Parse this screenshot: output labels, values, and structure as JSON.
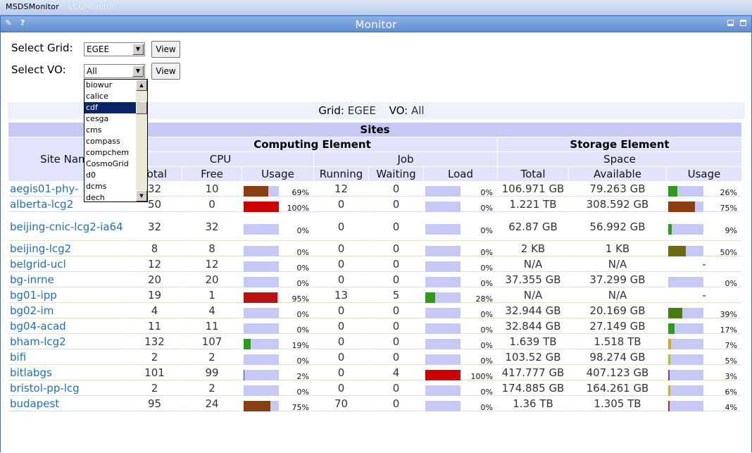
{
  "tabs": [
    {
      "label": "MSDSMonitor",
      "active": true
    },
    {
      "label": "LCGMonitor",
      "active": false
    }
  ],
  "portlet": {
    "title": "Monitor"
  },
  "controls": {
    "grid_label": "Select Grid:",
    "grid_value": "EGEE",
    "vo_label": "Select VO:",
    "vo_value": "All",
    "view_label": "View"
  },
  "vo_dropdown": {
    "options": [
      "biowur",
      "calice",
      "cdf",
      "cesga",
      "cms",
      "compass",
      "compchem",
      "CosmoGrid",
      "d0",
      "dcms",
      "dech"
    ],
    "selected": "cdf"
  },
  "info": {
    "grid_key": "Grid:",
    "grid_value": "EGEE",
    "vo_key": "VO:",
    "vo_value": "All"
  },
  "table": {
    "sites_title": "Sites",
    "site_name_header": "Site Name",
    "computing_element": "Computing Element",
    "storage_element": "Storage Element",
    "cpu_header": "CPU",
    "job_header": "Job",
    "space_header": "Space",
    "columns": [
      "Total",
      "Free",
      "Usage",
      "Running",
      "Waiting",
      "Load",
      "Total",
      "Available",
      "Usage"
    ],
    "rows": [
      {
        "name": "aegis01-phy-",
        "total": "32",
        "free": "10",
        "cpu_pct": 69,
        "cpu_color": "#8b3e0f",
        "running": "12",
        "waiting": "0",
        "load_pct": 0,
        "load_color": "#c6c9f5",
        "space_total": "106.971 GB",
        "available": "79.263 GB",
        "se_pct": 26,
        "se_color": "#2e9b1a",
        "se_text": "26%"
      },
      {
        "name": "alberta-lcg2",
        "total": "50",
        "free": "0",
        "cpu_pct": 100,
        "cpu_color": "#cc0000",
        "running": "0",
        "waiting": "0",
        "load_pct": 0,
        "load_color": "#c6c9f5",
        "space_total": "1.221 TB",
        "available": "308.592 GB",
        "se_pct": 75,
        "se_color": "#8b3e0f",
        "se_text": "75%"
      },
      {
        "name": "beijing-cnic-lcg2-ia64",
        "total": "32",
        "free": "32",
        "cpu_pct": 0,
        "cpu_color": "#c6c9f5",
        "running": "0",
        "waiting": "0",
        "load_pct": 0,
        "load_color": "#c6c9f5",
        "space_total": "62.87 GB",
        "available": "56.992 GB",
        "se_pct": 9,
        "se_color": "#2e9b1a",
        "se_text": "9%"
      },
      {
        "name": "beijing-lcg2",
        "total": "8",
        "free": "8",
        "cpu_pct": 0,
        "cpu_color": "#c6c9f5",
        "running": "0",
        "waiting": "0",
        "load_pct": 0,
        "load_color": "#c6c9f5",
        "space_total": "2 KB",
        "available": "1 KB",
        "se_pct": 50,
        "se_color": "#6b6b0f",
        "se_text": "50%"
      },
      {
        "name": "belgrid-ucl",
        "total": "12",
        "free": "12",
        "cpu_pct": 0,
        "cpu_color": "#c6c9f5",
        "running": "0",
        "waiting": "0",
        "load_pct": 0,
        "load_color": "#c6c9f5",
        "space_total": "N/A",
        "available": "N/A",
        "se_pct": null,
        "se_color": "",
        "se_text": "-"
      },
      {
        "name": "bg-inrne",
        "total": "20",
        "free": "20",
        "cpu_pct": 0,
        "cpu_color": "#c6c9f5",
        "running": "0",
        "waiting": "0",
        "load_pct": 0,
        "load_color": "#c6c9f5",
        "space_total": "37.355 GB",
        "available": "37.299 GB",
        "se_pct": 0,
        "se_color": "#c6c9f5",
        "se_text": "0%"
      },
      {
        "name": "bg01-ipp",
        "total": "19",
        "free": "1",
        "cpu_pct": 95,
        "cpu_color": "#bb1111",
        "running": "13",
        "waiting": "5",
        "load_pct": 28,
        "load_color": "#2e9b1a",
        "space_total": "N/A",
        "available": "N/A",
        "se_pct": null,
        "se_color": "",
        "se_text": "-"
      },
      {
        "name": "bg02-im",
        "total": "4",
        "free": "4",
        "cpu_pct": 0,
        "cpu_color": "#c6c9f5",
        "running": "0",
        "waiting": "0",
        "load_pct": 0,
        "load_color": "#c6c9f5",
        "space_total": "32.944 GB",
        "available": "20.169 GB",
        "se_pct": 39,
        "se_color": "#4a7a10",
        "se_text": "39%"
      },
      {
        "name": "bg04-acad",
        "total": "11",
        "free": "11",
        "cpu_pct": 0,
        "cpu_color": "#c6c9f5",
        "running": "0",
        "waiting": "0",
        "load_pct": 0,
        "load_color": "#c6c9f5",
        "space_total": "32.844 GB",
        "available": "27.149 GB",
        "se_pct": 17,
        "se_color": "#2e9b1a",
        "se_text": "17%"
      },
      {
        "name": "bham-lcg2",
        "total": "132",
        "free": "107",
        "cpu_pct": 19,
        "cpu_color": "#2e9b1a",
        "running": "0",
        "waiting": "0",
        "load_pct": 0,
        "load_color": "#c6c9f5",
        "space_total": "1.639 TB",
        "available": "1.518 TB",
        "se_pct": 7,
        "se_color": "#e8a020",
        "se_text": "7%"
      },
      {
        "name": "bifi",
        "total": "2",
        "free": "2",
        "cpu_pct": 0,
        "cpu_color": "#c6c9f5",
        "running": "0",
        "waiting": "0",
        "load_pct": 0,
        "load_color": "#c6c9f5",
        "space_total": "103.52 GB",
        "available": "98.274 GB",
        "se_pct": 5,
        "se_color": "#9ad020",
        "se_text": "5%"
      },
      {
        "name": "bitlabgs",
        "total": "101",
        "free": "99",
        "cpu_pct": 2,
        "cpu_color": "#2e4ea0",
        "running": "0",
        "waiting": "4",
        "load_pct": 100,
        "load_color": "#cc0000",
        "space_total": "417.777 GB",
        "available": "407.123 GB",
        "se_pct": 3,
        "se_color": "#7a3ea0",
        "se_text": "3%"
      },
      {
        "name": "bristol-pp-lcg",
        "total": "2",
        "free": "2",
        "cpu_pct": 0,
        "cpu_color": "#c6c9f5",
        "running": "0",
        "waiting": "0",
        "load_pct": 0,
        "load_color": "#c6c9f5",
        "space_total": "174.885 GB",
        "available": "164.261 GB",
        "se_pct": 6,
        "se_color": "#d0b020",
        "se_text": "6%"
      },
      {
        "name": "budapest",
        "total": "95",
        "free": "24",
        "cpu_pct": 75,
        "cpu_color": "#8b3e0f",
        "running": "70",
        "waiting": "0",
        "load_pct": 0,
        "load_color": "#c6c9f5",
        "space_total": "1.36 TB",
        "available": "1.305 TB",
        "se_pct": 4,
        "se_color": "#cc2222",
        "se_text": "4%"
      }
    ]
  }
}
